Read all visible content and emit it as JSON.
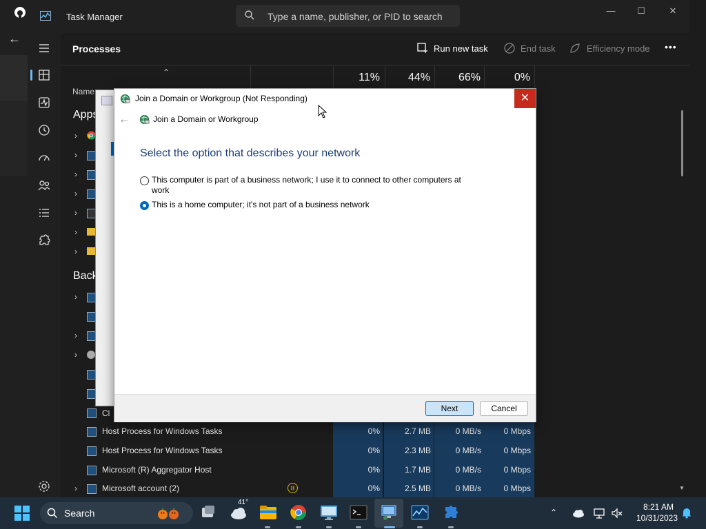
{
  "task_manager": {
    "title": "Task Manager",
    "search_placeholder": "Type a name, publisher, or PID to search",
    "window_controls": {
      "minimize": "—",
      "maximize": "☐",
      "close": "✕"
    },
    "page_title": "Processes",
    "toolbar": {
      "run_new_task": "Run new task",
      "end_task": "End task",
      "efficiency_mode": "Efficiency mode",
      "more": "•••"
    },
    "columns": {
      "name": "Name",
      "cpu_pct": "11%",
      "memory_pct": "44%",
      "disk_pct": "66%",
      "network_pct": "0%"
    },
    "groups": {
      "apps": "Apps",
      "background": "Back"
    },
    "rows": [
      {
        "name": "Host Process for Windows Tasks",
        "cpu": "0%",
        "memory": "2.7 MB",
        "disk": "0 MB/s",
        "network": "0 Mbps"
      },
      {
        "name": "Host Process for Windows Tasks",
        "cpu": "0%",
        "memory": "2.3 MB",
        "disk": "0 MB/s",
        "network": "0 Mbps"
      },
      {
        "name": "Microsoft (R) Aggregator Host",
        "cpu": "0%",
        "memory": "1.7 MB",
        "disk": "0 MB/s",
        "network": "0 Mbps"
      },
      {
        "name": "Microsoft account (2)",
        "cpu": "0%",
        "memory": "2.5 MB",
        "disk": "0 MB/s",
        "network": "0 Mbps"
      }
    ],
    "partial_row_text": "Cl"
  },
  "dialog": {
    "title": "Join a Domain or Workgroup (Not Responding)",
    "subtitle": "Join a Domain or Workgroup",
    "heading": "Select the option that describes your network",
    "options": [
      {
        "label": "This computer is part of a business network; I use it to connect to other computers at work",
        "selected": false
      },
      {
        "label": "This is a home computer; it's not part of a business network",
        "selected": true
      }
    ],
    "next_label": "Next",
    "cancel_label": "Cancel",
    "close_glyph": "✕"
  },
  "taskbar": {
    "search_label": "Search",
    "weather_temp": "41°",
    "time": "8:21 AM",
    "date": "10/31/2023"
  },
  "colors": {
    "accent": "#0067c0",
    "close_red": "#c42b1c",
    "heading_blue": "#1e3d7a",
    "taskbar_bg": "#1f2c3a"
  }
}
